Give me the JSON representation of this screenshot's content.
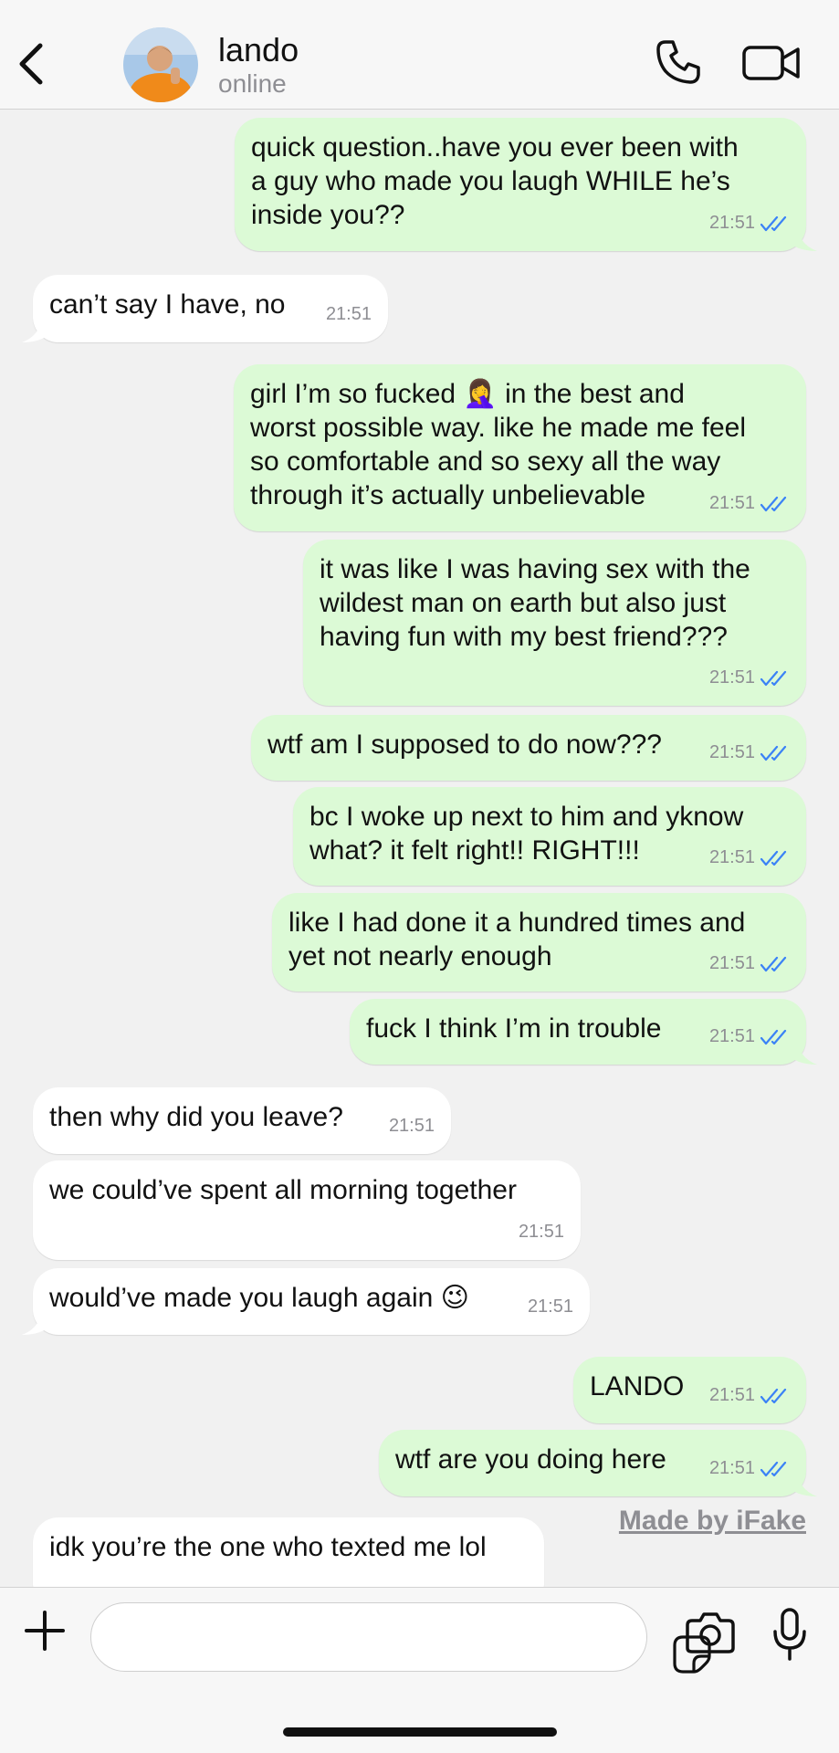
{
  "header": {
    "contact_name": "lando",
    "status": "online",
    "icons": {
      "back": "chevron-left-icon",
      "call": "phone-icon",
      "video": "video-camera-icon"
    }
  },
  "messages": [
    {
      "direction": "outgoing",
      "text": "quick question..have you ever been with\na guy who made you laugh WHILE he’s\ninside you??",
      "time": "21:51",
      "read": true
    },
    {
      "direction": "incoming",
      "text": "can’t say I have, no",
      "time": "21:51"
    },
    {
      "direction": "outgoing",
      "text": "girl I’m so fucked 🤦‍♀️ in the best and\nworst possible way. like he made me feel\nso comfortable and so sexy all the way\nthrough it’s actually unbelievable",
      "time": "21:51",
      "read": true
    },
    {
      "direction": "outgoing",
      "text": "it was like I was having sex with the\nwildest man on earth but also just\nhaving fun with my best friend???",
      "time": "21:51",
      "read": true
    },
    {
      "direction": "outgoing",
      "text": "wtf am I supposed to do now???",
      "time": "21:51",
      "read": true
    },
    {
      "direction": "outgoing",
      "text": "bc I woke up next to him and yknow\nwhat? it felt right!! RIGHT!!!",
      "time": "21:51",
      "read": true
    },
    {
      "direction": "outgoing",
      "text": "like I had done it a hundred times and\nyet not nearly enough",
      "time": "21:51",
      "read": true
    },
    {
      "direction": "outgoing",
      "text": "fuck I think I’m in trouble",
      "time": "21:51",
      "read": true
    },
    {
      "direction": "incoming",
      "text": "then why did you leave?",
      "time": "21:51"
    },
    {
      "direction": "incoming",
      "text": "we could’ve spent all morning together",
      "time": "21:51"
    },
    {
      "direction": "incoming",
      "text": "would’ve made you laugh again 😉",
      "time": "21:51"
    },
    {
      "direction": "outgoing",
      "text": "LANDO",
      "time": "21:51",
      "read": true
    },
    {
      "direction": "outgoing",
      "text": "wtf are you doing here",
      "time": "21:51",
      "read": true
    },
    {
      "direction": "incoming",
      "text": "idk you’re the one who texted me lol",
      "time": ""
    }
  ],
  "watermark": "Made by iFake",
  "composer": {
    "value": "",
    "placeholder": "",
    "icons": {
      "attach": "plus-icon",
      "sticker": "sticker-icon",
      "camera": "camera-icon",
      "mic": "microphone-icon"
    }
  },
  "colors": {
    "outgoing_bubble": "#dcfad6",
    "incoming_bubble": "#ffffff",
    "read_ticks": "#3b82f6",
    "background": "#f1f1f1"
  }
}
